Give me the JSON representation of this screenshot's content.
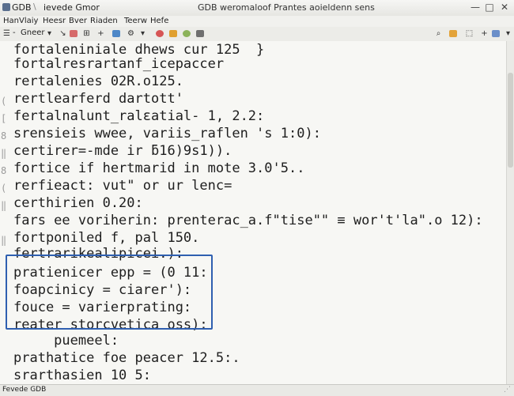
{
  "window": {
    "app_title": "GDB",
    "tab_label": "ievede Gmor",
    "document_title": "GDB weromaloof Prantes aoieldenn sens",
    "controls": {
      "minimize": "—",
      "maximize": "□",
      "close": "✕"
    }
  },
  "menu": [
    "Han",
    "Vlaiy",
    "Heesr",
    "Bver",
    "Riaden",
    "Teerw",
    "Hefe"
  ],
  "toolbar": {
    "dropdown_label": "Gneer",
    "dropdown_arrow": "▾",
    "icons_left": [
      "≡",
      "↘",
      "⊞",
      "+",
      "⌖",
      "⚙",
      "▾"
    ],
    "icons_right": [
      "⬚",
      "+",
      "▾"
    ]
  },
  "editor": {
    "lines": [
      "fortaleniniale dhews cur 125  }",
      "fortalresrartanf_icepaccer",
      "rertalenies 02R.o125.",
      "rertlearferd dartott'",
      "fertalnalunt_ralεatial- 1, 2.2:",
      "srensieis wwee, variis_raflen 's 1:0):",
      "certirer=-mde ir ƃ16)9s1)).",
      "fortice if hertmarid in mote 3.0'5..",
      "rerfieact: vut\" or ur lenc=",
      "certhirien 0.20:",
      "fars ee voriherin: prenterac_a.f\"tise\"\" ≡ wor't'la\".o 12):",
      "fortponiled f, pal 150.",
      "fertrarikealipicei.):",
      "pratienicer epp = (0 11:",
      "foapcinicy = ciarer'):",
      "fouce = varierprating:",
      "reater storcvetica oss):",
      "     puemeel:",
      "prathatice foe peacer 12.5:.",
      "srarthasien 10 5:"
    ],
    "gutter_marks": [
      "(",
      "[",
      "8",
      "‖",
      "8",
      "(",
      "‖",
      "‖"
    ]
  },
  "status": {
    "text": "Fevede GDB"
  }
}
